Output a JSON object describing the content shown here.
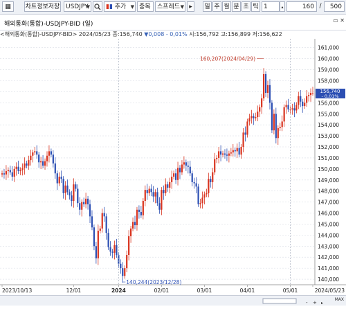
{
  "toolbar": {
    "chart_btn": "▦",
    "save_label": "차트정보저장",
    "symbol": "USDJPY",
    "add_label": "추가",
    "overlay_label": "중복",
    "spread_label": "스프레드",
    "periods": [
      "일",
      "주",
      "월",
      "분",
      "초",
      "틱"
    ],
    "interval_value": "1",
    "count_value": "160",
    "total_value": "500"
  },
  "title": "해외통화(통합)-USDJPY-BID (일)",
  "infobar": {
    "prefix": "<해외통화(통합)-USDJPY-BID> 2024/05/23 종:156,740",
    "change": "▼0,008 - 0,01%",
    "suffix": "시:156,792 고:156,899 저:156,622"
  },
  "chart_data": {
    "type": "candlestick",
    "symbol": "USDJPY-BID",
    "period": "daily",
    "ylim": [
      139.5,
      161.8
    ],
    "y_ticks": [
      140,
      141,
      142,
      143,
      144,
      145,
      146,
      147,
      148,
      149,
      150,
      151,
      152,
      153,
      154,
      155,
      156,
      157,
      158,
      159,
      160,
      161
    ],
    "y_tick_labels": [
      "140,000",
      "141,000",
      "142,000",
      "143,000",
      "144,000",
      "145,000",
      "146,000",
      "147,000",
      "148,000",
      "149,000",
      "150,000",
      "151,000",
      "152,000",
      "153,000",
      "154,000",
      "155,000",
      "156,000",
      "157,000",
      "158,000",
      "159,000",
      "160,000",
      "161,000"
    ],
    "x_labels": [
      "2023/10/13",
      "12/01",
      "2024",
      "02/01",
      "03/01",
      "04/01",
      "05/01",
      "2024/05/23"
    ],
    "current_price": "156,740",
    "current_change": "- 0,01%",
    "max_annotation": "160,207(2024/04/29)",
    "min_annotation": "140,244(2023/12/28)",
    "closes": [
      149.6,
      149.5,
      149.8,
      149.9,
      149.7,
      149.3,
      150.0,
      150.2,
      149.8,
      149.9,
      150.1,
      150.5,
      150.3,
      150.8,
      151.2,
      151.5,
      151.6,
      151.3,
      150.6,
      150.7,
      150.3,
      150.7,
      151.2,
      151.6,
      151.3,
      150.5,
      149.6,
      148.7,
      149.3,
      149.1,
      147.8,
      148.5,
      147.9,
      147.6,
      147.1,
      148.6,
      148.2,
      146.9,
      146.3,
      147.0,
      146.8,
      147.3,
      146.8,
      145.7,
      144.7,
      143.0,
      141.9,
      144.4,
      144.6,
      146.0,
      145.7,
      144.2,
      142.9,
      142.5,
      142.4,
      143.1,
      142.2,
      141.4,
      141.0,
      140.3,
      141.0,
      142.2,
      143.9,
      144.6,
      145.2,
      144.9,
      146.3,
      146.1,
      145.8,
      147.1,
      148.1,
      147.8,
      148.2,
      147.9,
      147.5,
      147.9,
      146.9,
      146.3,
      148.1,
      147.8,
      148.6,
      148.3,
      148.8,
      149.3,
      149.6,
      149.0,
      150.1,
      149.7,
      150.4,
      150.6,
      150.3,
      150.2,
      149.6,
      148.8,
      148.7,
      148.4,
      146.8,
      146.9,
      147.4,
      147.7,
      147.8,
      149.1,
      148.8,
      149.7,
      150.9,
      151.0,
      151.6,
      151.3,
      151.4,
      151.3,
      151.2,
      151.4,
      151.5,
      151.7,
      151.6,
      151.9,
      151.3,
      152.0,
      153.3,
      153.1,
      154.3,
      154.6,
      154.8,
      154.6,
      154.7,
      155.2,
      155.6,
      156.4,
      158.6,
      156.9,
      157.6,
      156.0,
      153.5,
      155.0,
      152.8,
      153.7,
      153.8,
      154.3,
      155.6,
      155.8,
      155.4,
      155.4,
      155.5,
      155.3,
      155.8,
      156.6,
      156.1,
      155.7,
      156.0,
      156.6,
      156.7,
      156.9,
      156.9
    ]
  },
  "bottombar": {
    "right_label": "MAX"
  },
  "colors": {
    "up": "#d9341f",
    "down": "#2c4fb3",
    "grid": "#d9dde5",
    "panel": "#eef1f6"
  }
}
